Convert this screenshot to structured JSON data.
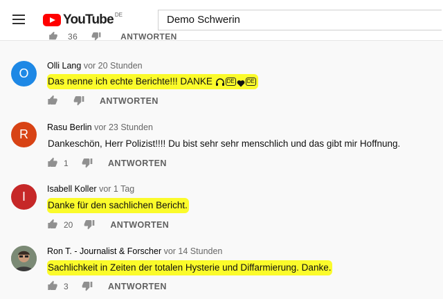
{
  "header": {
    "logo_text": "YouTube",
    "country_code": "DE",
    "search_value": "Demo Schwerin"
  },
  "previous_comment": {
    "likes": "36",
    "reply_label": "ANTWORTEN"
  },
  "comments": [
    {
      "author": "Olli Lang",
      "time": "vor 20 Stunden",
      "avatar_letter": "O",
      "avatar_color": "#1e88e5",
      "text": "Das nenne ich echte Berichte!!! DANKE ",
      "emoji_suffix": [
        "DE",
        "DE"
      ],
      "highlighted": true,
      "likes": "",
      "reply_label": "ANTWORTEN"
    },
    {
      "author": "Rasu Berlin",
      "time": "vor 23 Stunden",
      "avatar_letter": "R",
      "avatar_color": "#d84315",
      "text": "Dankeschön, Herr Polizist!!!!  Du bist sehr sehr menschlich und das gibt mir Hoffnung.",
      "highlighted": false,
      "likes": "1",
      "reply_label": "ANTWORTEN"
    },
    {
      "author": "Isabell Koller",
      "time": "vor 1 Tag",
      "avatar_letter": "I",
      "avatar_color": "#c62828",
      "text": "Danke für den sachlichen Bericht.",
      "highlighted": true,
      "likes": "20",
      "reply_label": "ANTWORTEN"
    },
    {
      "author": "Ron T. - Journalist & Forscher",
      "time": "vor 14 Stunden",
      "avatar_letter": "",
      "avatar_color": "#6d7b6a",
      "text": "Sachlichkeit in Zeiten der totalen Hysterie und Diffarmierung. Danke.",
      "highlighted": true,
      "likes": "3",
      "reply_label": "ANTWORTEN"
    }
  ],
  "colors": {
    "highlight": "#fbfb2b",
    "youtube_red": "#ff0000"
  }
}
